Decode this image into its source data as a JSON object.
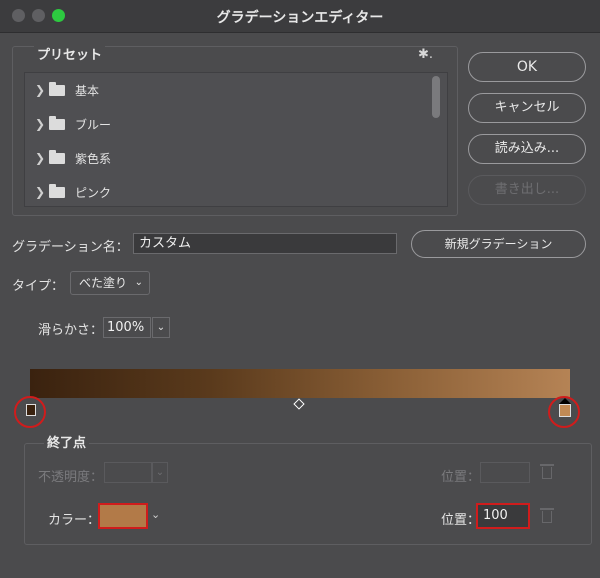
{
  "window": {
    "title": "グラデーションエディター"
  },
  "presets": {
    "label": "プリセット",
    "gear_glyph": "✱.",
    "items": [
      {
        "label": "基本"
      },
      {
        "label": "ブルー"
      },
      {
        "label": "紫色系"
      },
      {
        "label": "ピンク"
      }
    ]
  },
  "buttons": {
    "ok": "OK",
    "cancel": "キャンセル",
    "load": "読み込み...",
    "export": "書き出し...",
    "new_gradient": "新規グラデーション"
  },
  "name": {
    "label": "グラデーション名：",
    "value": "カスタム"
  },
  "type": {
    "label": "タイプ：",
    "value": "べた塗り",
    "chevron": "⌄"
  },
  "smoothness": {
    "label": "滑らかさ：",
    "value": "100%",
    "chevron": "⌄"
  },
  "gradient": {
    "colors": [
      "#3a220f",
      "#5a3a1c",
      "#8a5f36",
      "#b58355"
    ],
    "left_stop_color": "#3a220f",
    "right_stop_color": "#c08a55"
  },
  "stops": {
    "label": "終了点",
    "opacity_label": "不透明度：",
    "opacity_value": "",
    "opacity_position_label": "位置：",
    "opacity_position_value": "",
    "color_label": "カラー：",
    "color_value": "#b27a48",
    "color_chevron": "⌄",
    "color_position_label": "位置：",
    "color_position_value": "100"
  },
  "highlight_color": "#d01c1c"
}
